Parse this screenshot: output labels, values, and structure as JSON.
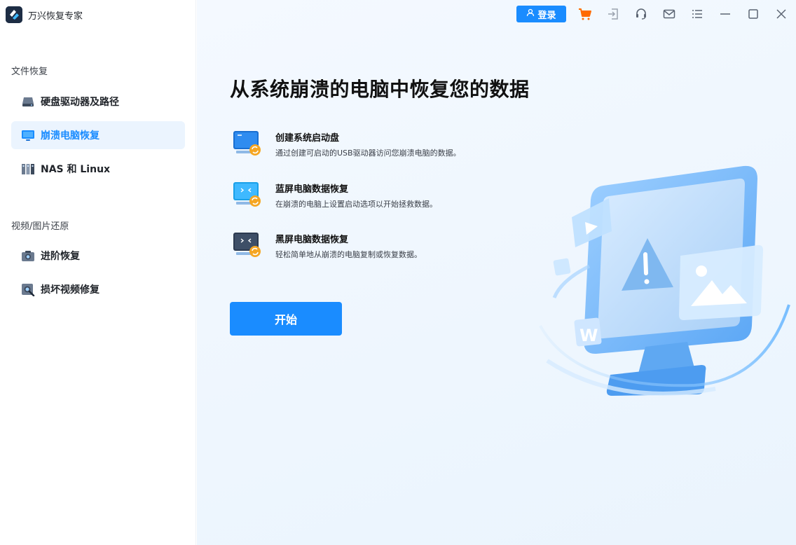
{
  "app": {
    "title": "万兴恢复专家"
  },
  "sidebar": {
    "sections": [
      {
        "label": "文件恢复",
        "items": [
          {
            "label": "硬盘驱动器及路径",
            "icon": "hard-drive-icon"
          },
          {
            "label": "崩溃电脑恢复",
            "icon": "monitor-icon",
            "active": true
          },
          {
            "label": "NAS 和 Linux",
            "icon": "nas-icon"
          }
        ]
      },
      {
        "label": "视频/图片还原",
        "items": [
          {
            "label": "进阶恢复",
            "icon": "camera-icon"
          },
          {
            "label": "损坏视频修复",
            "icon": "video-repair-icon"
          }
        ]
      }
    ]
  },
  "toolbar": {
    "login_label": "登录",
    "icons": [
      "user-icon",
      "cart-icon",
      "sign-in-icon",
      "headset-icon",
      "mail-icon",
      "list-menu-icon",
      "minimize-icon",
      "maximize-icon",
      "close-icon"
    ]
  },
  "main": {
    "headline": "从系统崩溃的电脑中恢复您的数据",
    "features": [
      {
        "title": "创建系统启动盘",
        "desc": "通过创建可启动的USB驱动器访问您崩溃电脑的数据。",
        "icon": "bootable-drive-icon"
      },
      {
        "title": "蓝屏电脑数据恢复",
        "desc": "在崩溃的电脑上设置启动选项以开始拯救数据。",
        "icon": "blue-screen-icon"
      },
      {
        "title": "黑屏电脑数据恢复",
        "desc": "轻松简单地从崩溃的电脑复制或恢复数据。",
        "icon": "black-screen-icon"
      }
    ],
    "start_label": "开始"
  },
  "colors": {
    "accent": "#1a8cff",
    "active_bg": "#ebf4fe",
    "main_bg": "#eef6fe"
  }
}
